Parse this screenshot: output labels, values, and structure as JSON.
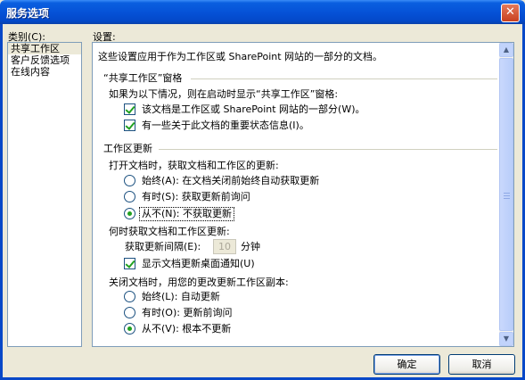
{
  "window": {
    "title": "服务选项",
    "close_glyph": "✕"
  },
  "categories": {
    "label": "类别(C):",
    "items": [
      {
        "label": "共享工作区",
        "selected": true
      },
      {
        "label": "客户反馈选项",
        "selected": false
      },
      {
        "label": "在线内容",
        "selected": false
      }
    ]
  },
  "settings": {
    "label": "设置:",
    "intro": "这些设置应用于作为工作区或 SharePoint 网站的一部分的文档。",
    "pane_section": {
      "heading": "“共享工作区”窗格",
      "prompt": "如果为以下情况，则在启动时显示“共享工作区”窗格:",
      "options": [
        {
          "label": "该文档是工作区或 SharePoint 网站的一部分(W)。",
          "checked": true
        },
        {
          "label": "有一些关于此文档的重要状态信息(I)。",
          "checked": true
        }
      ]
    },
    "update_section": {
      "heading": "工作区更新",
      "open_prompt": "打开文档时，获取文档和工作区的更新:",
      "open_options": [
        {
          "label": "始终(A): 在文档关闭前始终自动获取更新",
          "selected": false
        },
        {
          "label": "有时(S): 获取更新前询问",
          "selected": false
        },
        {
          "label": "从不(N): 不获取更新",
          "selected": true
        }
      ],
      "when_prompt": "何时获取文档和工作区更新:",
      "interval_label": "获取更新间隔(E):",
      "interval_value": "10",
      "interval_unit": "分钟",
      "notify_label": "显示文档更新桌面通知(U)",
      "notify_checked": true,
      "close_prompt": "关闭文档时，用您的更改更新工作区副本:",
      "close_options": [
        {
          "label": "始终(L): 自动更新",
          "selected": false
        },
        {
          "label": "有时(O): 更新前询问",
          "selected": false
        },
        {
          "label": "从不(V): 根本不更新",
          "selected": true
        }
      ]
    }
  },
  "buttons": {
    "ok": "确定",
    "cancel": "取消"
  },
  "scrollbar": {
    "up_glyph": "▲",
    "down_glyph": "▼"
  },
  "colors": {
    "title_bar": "#0551d6",
    "dialog_bg": "#ece9d8",
    "check_mark": "#21a121"
  }
}
